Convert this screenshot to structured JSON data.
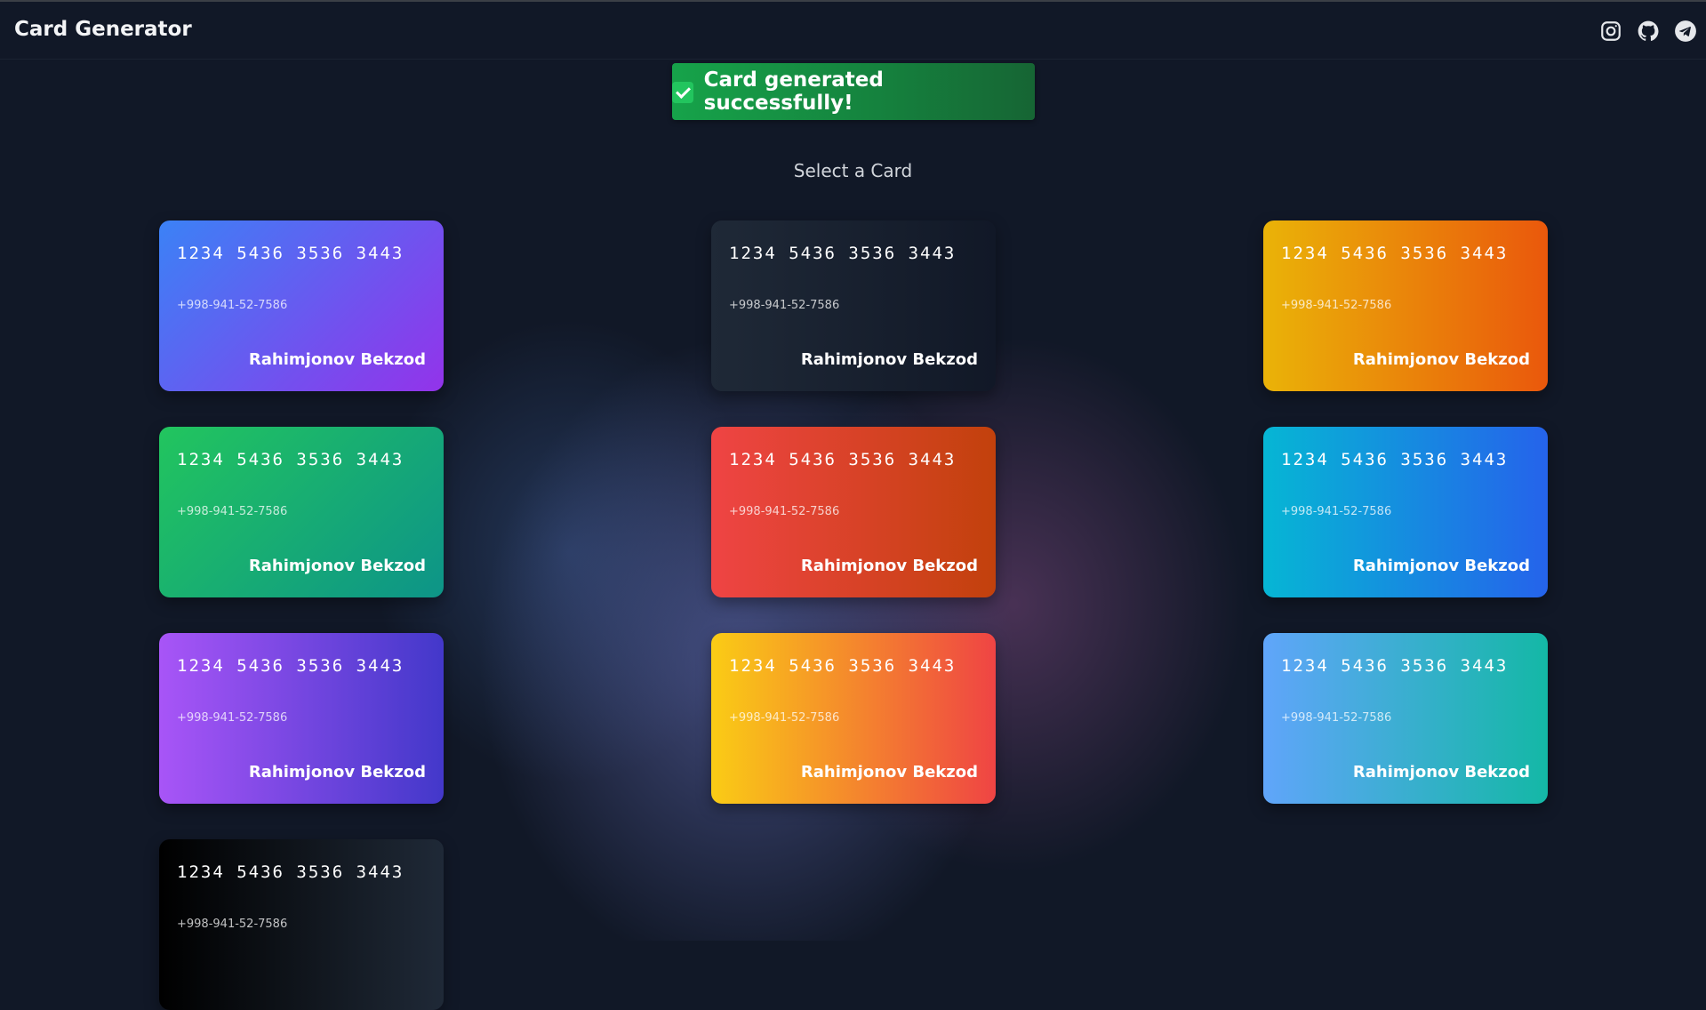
{
  "app": {
    "title": "Card Generator"
  },
  "social": [
    {
      "name": "instagram-icon",
      "color": "#e5e7eb"
    },
    {
      "name": "github-icon",
      "color": "#e5e7eb"
    },
    {
      "name": "telegram-icon",
      "color": "#e5e7eb"
    }
  ],
  "toast": {
    "text": "Card generated successfully!",
    "icon": "check-mark-icon"
  },
  "section_title": "Select a Card",
  "cards": [
    {
      "number": "1234 5436 3536 3443",
      "phone": "+998-941-52-7586",
      "name": "Rahimjonov Bekzod",
      "gradient": [
        "#3b82f6",
        "#9333ea"
      ]
    },
    {
      "number": "1234 5436 3536 3443",
      "phone": "+998-941-52-7586",
      "name": "Rahimjonov Bekzod",
      "gradient": [
        "#1f2937",
        "#111827"
      ]
    },
    {
      "number": "1234 5436 3536 3443",
      "phone": "+998-941-52-7586",
      "name": "Rahimjonov Bekzod",
      "gradient": [
        "#eab308",
        "#ea580c"
      ]
    },
    {
      "number": "1234 5436 3536 3443",
      "phone": "+998-941-52-7586",
      "name": "Rahimjonov Bekzod",
      "gradient": [
        "#22c55e",
        "#0d9488"
      ]
    },
    {
      "number": "1234 5436 3536 3443",
      "phone": "+998-941-52-7586",
      "name": "Rahimjonov Bekzod",
      "gradient": [
        "#ef4444",
        "#c2410c"
      ]
    },
    {
      "number": "1234 5436 3536 3443",
      "phone": "+998-941-52-7586",
      "name": "Rahimjonov Bekzod",
      "gradient": [
        "#06b6d4",
        "#2563eb"
      ]
    },
    {
      "number": "1234 5436 3536 3443",
      "phone": "+998-941-52-7586",
      "name": "Rahimjonov Bekzod",
      "gradient": [
        "#a855f7",
        "#4338ca"
      ]
    },
    {
      "number": "1234 5436 3536 3443",
      "phone": "+998-941-52-7586",
      "name": "Rahimjonov Bekzod",
      "gradient": [
        "#facc15",
        "#ef4444"
      ]
    },
    {
      "number": "1234 5436 3536 3443",
      "phone": "+998-941-52-7586",
      "name": "Rahimjonov Bekzod",
      "gradient": [
        "#60a5fa",
        "#14b8a6"
      ]
    },
    {
      "number": "1234 5436 3536 3443",
      "phone": "+998-941-52-7586",
      "gradient": [
        "#000000",
        "#1f2937"
      ]
    }
  ],
  "colors": {
    "background": "#111827",
    "toast": "#16a34a"
  }
}
